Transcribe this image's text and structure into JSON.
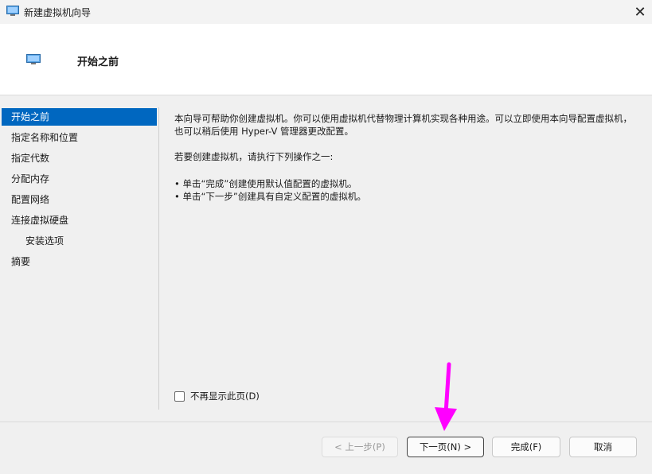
{
  "window": {
    "title": "新建虚拟机向导",
    "close_glyph": "✕"
  },
  "header": {
    "title": "开始之前"
  },
  "sidebar": {
    "items": [
      {
        "label": "开始之前",
        "selected": true
      },
      {
        "label": "指定名称和位置"
      },
      {
        "label": "指定代数"
      },
      {
        "label": "分配内存"
      },
      {
        "label": "配置网络"
      },
      {
        "label": "连接虚拟硬盘"
      },
      {
        "label": "安装选项"
      },
      {
        "label": "摘要"
      }
    ]
  },
  "content": {
    "para1": "本向导可帮助你创建虚拟机。你可以使用虚拟机代替物理计算机实现各种用途。可以立即使用本向导配置虚拟机，也可以稍后使用 Hyper-V 管理器更改配置。",
    "para2": "若要创建虚拟机，请执行下列操作之一:",
    "bullets": [
      "• 单击“完成”创建使用默认值配置的虚拟机。",
      "• 单击“下一步”创建具有自定义配置的虚拟机。"
    ]
  },
  "checkbox": {
    "label": "不再显示此页(D)",
    "checked": false
  },
  "buttons": {
    "prev": "< 上一步(P)",
    "next": "下一页(N) >",
    "finish": "完成(F)",
    "cancel": "取消"
  },
  "colors": {
    "selection": "#0067c0",
    "annotation_arrow": "#ff00ff"
  }
}
